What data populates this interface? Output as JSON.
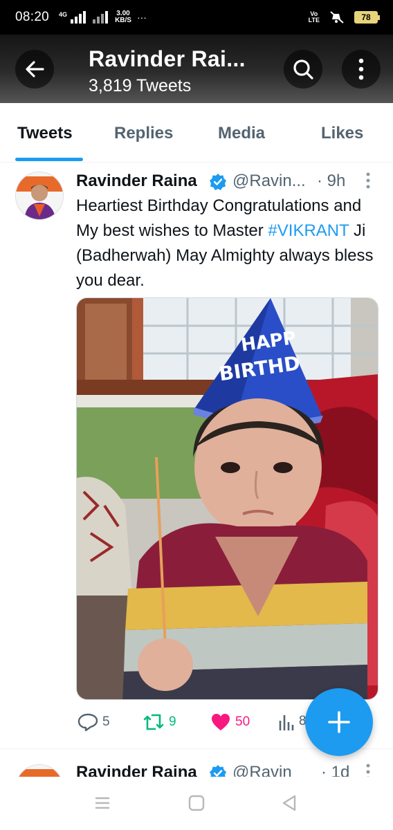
{
  "status_bar": {
    "time": "08:20",
    "network": "4G",
    "speed_value": "3.00",
    "speed_unit": "KB/S",
    "dots": "···",
    "volte_top": "Vo",
    "volte_bottom": "LTE",
    "battery": "78"
  },
  "header": {
    "title": "Ravinder Rai...",
    "subtitle": "3,819 Tweets"
  },
  "tabs": [
    {
      "label": "Tweets",
      "active": true
    },
    {
      "label": "Replies",
      "active": false
    },
    {
      "label": "Media",
      "active": false
    },
    {
      "label": "Likes",
      "active": false
    }
  ],
  "tweet": {
    "name": "Ravinder Raina",
    "handle": "@Ravin...",
    "time": "· 9h",
    "text_before": "Heartiest Birthday Congratulations and My best wishes to Master ",
    "hashtag": "#VIKRANT",
    "text_after": " Ji (Badherwah) May Almighty always bless you dear.",
    "image_hat_text_1": "HAPP",
    "image_hat_text_2": "BIRTHD",
    "reply_count": "5",
    "retweet_count": "9",
    "like_count": "50",
    "views_count": "8"
  },
  "next_tweet": {
    "name": "Ravinder Raina",
    "handle": "@Ravin",
    "time": "· 1d"
  },
  "colors": {
    "accent": "#1d9bf0",
    "retweet": "#00ba7c",
    "like": "#f91880",
    "secondary_text": "#536471"
  },
  "icons": {
    "back": "arrow-left-icon",
    "search": "search-icon",
    "more": "more-vertical-icon",
    "verified": "verified-badge-icon",
    "reply": "reply-icon",
    "retweet": "retweet-icon",
    "like": "heart-icon",
    "views": "views-icon",
    "compose": "plus-icon",
    "nav_recents": "recents-icon",
    "nav_home": "home-icon",
    "nav_back": "nav-back-icon"
  }
}
